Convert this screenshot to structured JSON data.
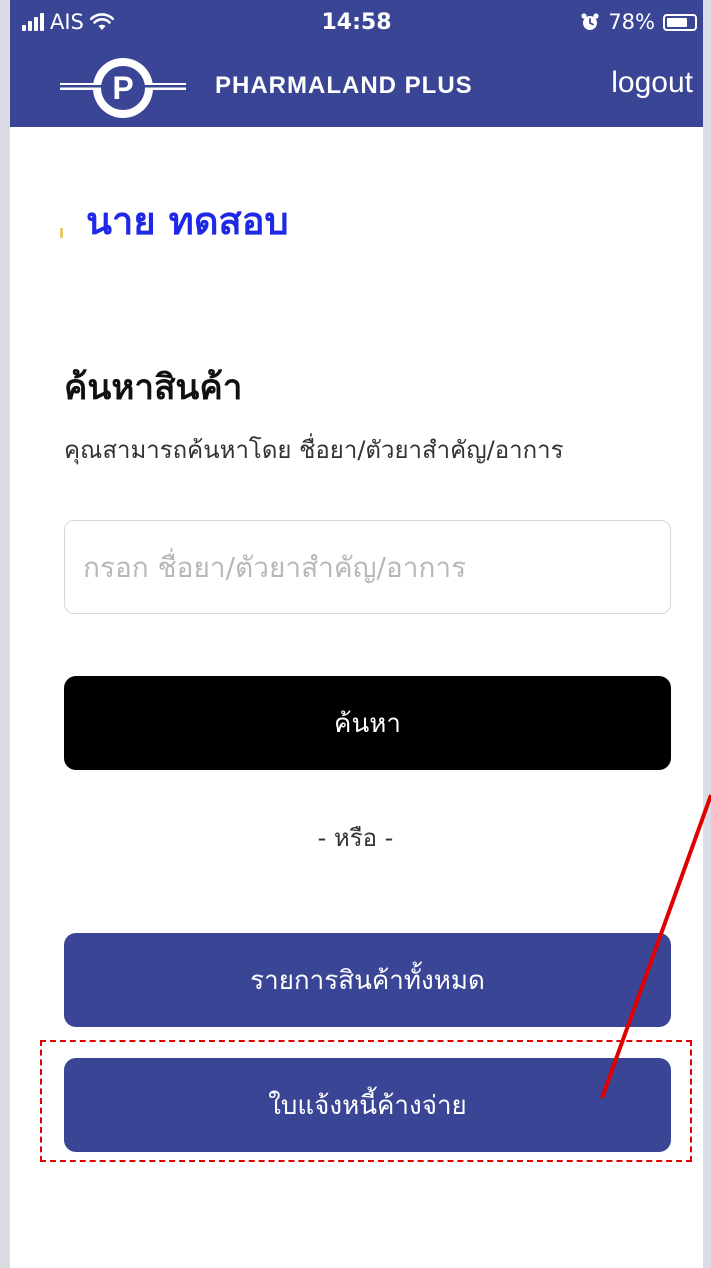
{
  "status_bar": {
    "carrier": "AIS",
    "time": "14:58",
    "battery_percent": "78%",
    "battery_level": 0.78
  },
  "header": {
    "logo_letter": "P",
    "brand": "PHARMALAND PLUS",
    "logout_label": "logout"
  },
  "user": {
    "name": "นาย ทดสอบ"
  },
  "search": {
    "title": "ค้นหาสินค้า",
    "subtitle": "คุณสามารถค้นหาโดย ชื่อยา/ตัวยาสำคัญ/อาการ",
    "placeholder": "กรอก ชื่อยา/ตัวยาสำคัญ/อาการ",
    "value": "",
    "button_label": "ค้นหา"
  },
  "divider_text": "- หรือ -",
  "actions": {
    "all_products_label": "รายการสินค้าทั้งหมด",
    "outstanding_invoice_label": "ใบแจ้งหนี้ค้างจ่าย"
  },
  "colors": {
    "primary": "#3a4595",
    "user_name": "#1e28e6",
    "search_button": "#000000",
    "annotation": "#e00000"
  }
}
